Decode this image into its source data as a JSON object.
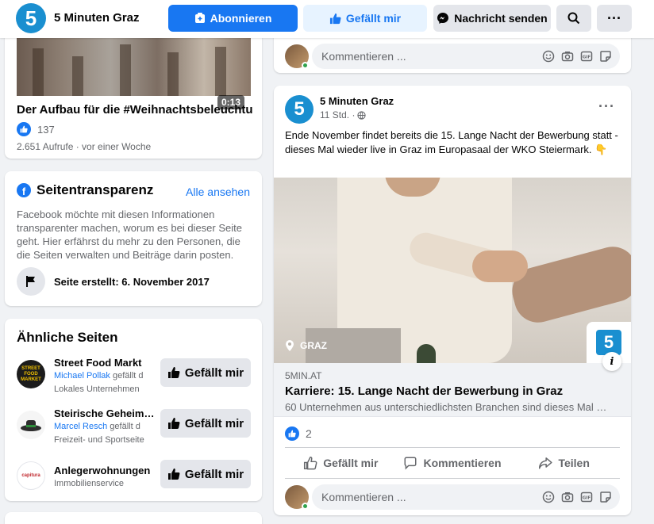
{
  "header": {
    "logo_text": "5",
    "page_name": "5 Minuten Graz",
    "subscribe_label": "Abonnieren",
    "like_label": "Gefällt mir",
    "message_label": "Nachricht senden",
    "more_label": "···"
  },
  "video": {
    "duration": "0:13",
    "title": "Der Aufbau für die #Weihnachtsbeleuchtung",
    "likes": "137",
    "meta": "2.651 Aufrufe · vor einer Woche"
  },
  "transparency": {
    "title": "Seitentransparenz",
    "see_all": "Alle ansehen",
    "text": "Facebook möchte mit diesen Informationen transparenter machen, worum es bei dieser Seite geht. Hier erfährst du mehr zu den Personen, die die Seiten verwalten und Beiträge darin posten.",
    "created": "Seite erstellt: 6. November 2017"
  },
  "similar": {
    "title": "Ähnliche Seiten",
    "button_label": "Gefällt mir",
    "items": [
      {
        "name": "Street Food Markt",
        "friend": "Michael Pollak",
        "friend_suffix": " gefällt d",
        "category": "Lokales Unternehmen",
        "logo_text": "STREET FOOD MARKET"
      },
      {
        "name": "Steirische Geheimtipps",
        "friend": "Marcel Resch",
        "friend_suffix": " gefällt d",
        "category": "Freizeit- und Sportseite",
        "logo_text": ""
      },
      {
        "name": "Anlegerwohnungen",
        "friend": "",
        "friend_suffix": "",
        "category": "Immobilienservice",
        "logo_text": "capitura"
      }
    ]
  },
  "comment": {
    "placeholder": "Kommentieren ..."
  },
  "post": {
    "logo_text": "5",
    "page_name": "5 Minuten Graz",
    "time": "11 Std. ·",
    "more": "···",
    "text": "Ende November findet bereits die 15. Lange Nacht der Bewerbung statt - dieses Mal wieder live in Graz im Europasaal der WKO Steiermark. 👇",
    "image_location": "GRAZ",
    "image_badge": "5",
    "info": "i",
    "link_domain": "5MIN.AT",
    "link_title": "Karriere: 15. Lange Nacht der Bewerbung in Graz",
    "link_desc": "60 Unternehmen aus unterschiedlichsten Branchen sind dieses Mal …",
    "reactions": "2",
    "actions": {
      "like": "Gefällt mir",
      "comment": "Kommentieren",
      "share": "Teilen"
    }
  },
  "colors": {
    "primary": "#1877f2",
    "brand": "#1a8fd0",
    "online": "#31a24c"
  }
}
